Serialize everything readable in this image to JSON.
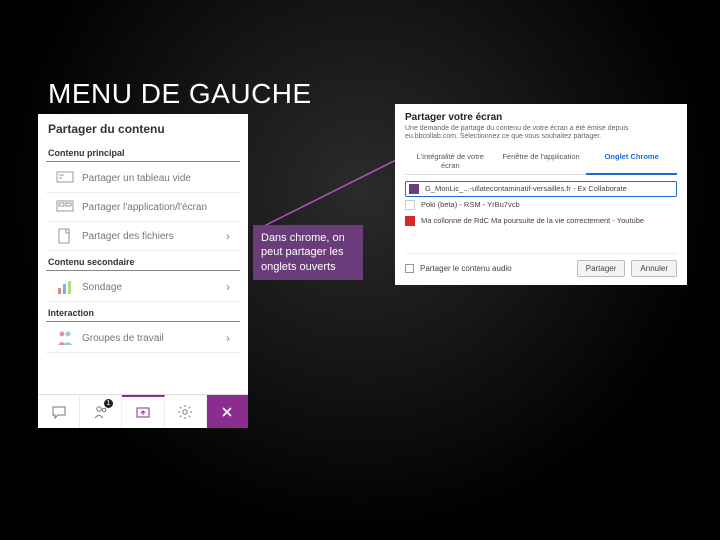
{
  "slide": {
    "title": "MENU DE GAUCHE"
  },
  "left_panel": {
    "header": "Partager du contenu",
    "section_primary": "Contenu principal",
    "items_primary": [
      {
        "label": "Partager un tableau vide"
      },
      {
        "label": "Partager l'application/l'écran"
      },
      {
        "label": "Partager des fichiers"
      }
    ],
    "section_secondary": "Contenu secondaire",
    "items_secondary": [
      {
        "label": "Sondage"
      }
    ],
    "section_interaction": "Interaction",
    "items_interaction": [
      {
        "label": "Groupes de travail"
      }
    ],
    "bottom_badge": "1"
  },
  "callout": {
    "text": "Dans chrome, on peut partager les onglets ouverts"
  },
  "right_dialog": {
    "title": "Partager votre écran",
    "desc": "Une demande de partage du contenu de votre écran a été émise depuis eu.bbcollab.com. Sélectionnez ce que vous souhaitez partager.",
    "tabs": [
      {
        "label": "L'intégralité de votre écran"
      },
      {
        "label": "Fenêtre de l'application"
      },
      {
        "label": "Onglet Chrome"
      }
    ],
    "rows": [
      {
        "label": "G_MonLic_...-ullatecontaminatif-versailles.fr - Ex Collaborate"
      },
      {
        "label": "Poki (beta) - RSM - YrBu7vcb"
      },
      {
        "label": "Ma collonne de RdC Ma poursuite de la vie correctement - Youtube"
      }
    ],
    "audio_label": "Partager le contenu audio",
    "btn_share": "Partager",
    "btn_cancel": "Annuler"
  }
}
